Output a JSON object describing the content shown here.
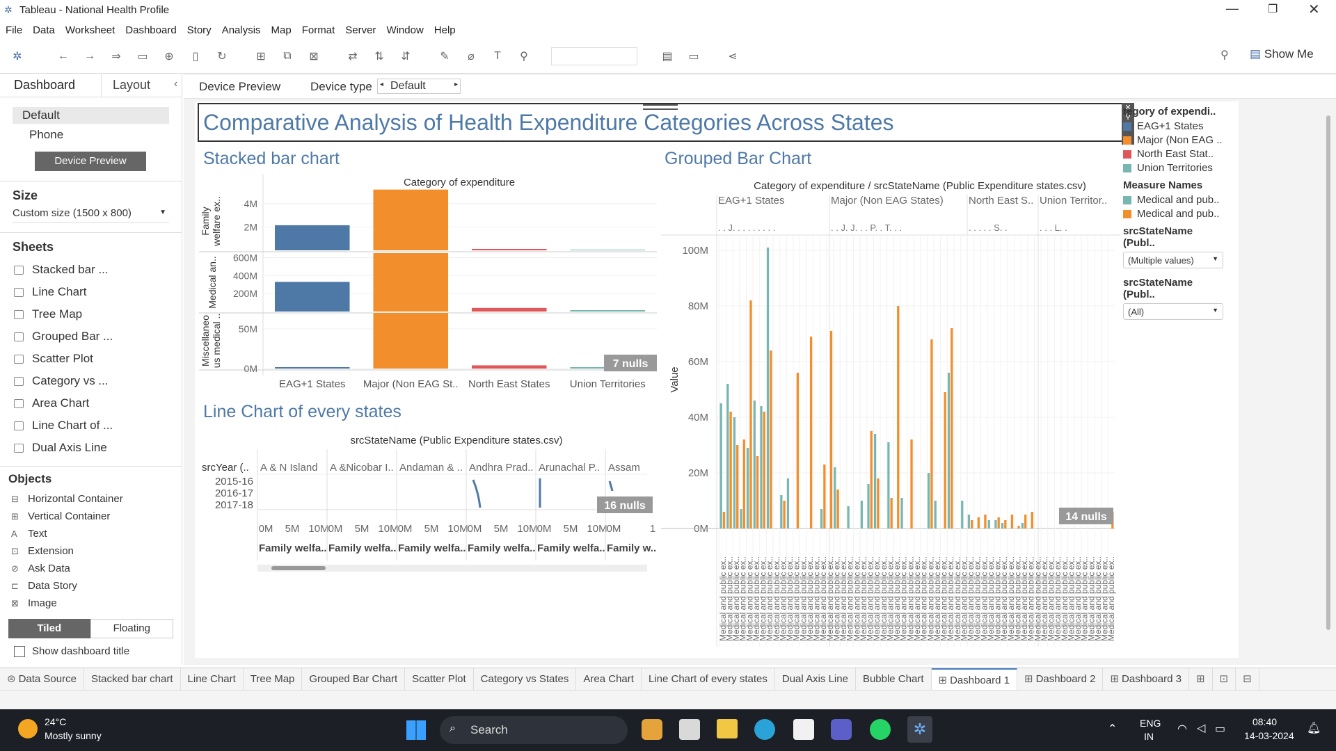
{
  "window": {
    "title": "Tableau - National Health Profile"
  },
  "menu": [
    "File",
    "Data",
    "Worksheet",
    "Dashboard",
    "Story",
    "Analysis",
    "Map",
    "Format",
    "Server",
    "Window",
    "Help"
  ],
  "toolbar": {
    "show_me": "Show Me"
  },
  "left": {
    "tab_dashboard": "Dashboard",
    "tab_layout": "Layout",
    "device_default": "Default",
    "device_phone": "Phone",
    "device_preview_btn": "Device Preview",
    "size_heading": "Size",
    "size_value": "Custom size (1500 x 800)",
    "sheets_heading": "Sheets",
    "sheets": [
      "Stacked bar ...",
      "Line Chart",
      "Tree Map",
      "Grouped Bar ...",
      "Scatter Plot",
      "Category vs ...",
      "Area Chart",
      "Line Chart of ...",
      "Dual Axis Line"
    ],
    "objects_heading": "Objects",
    "objects": [
      "Horizontal Container",
      "Vertical Container",
      "Text",
      "Extension",
      "Ask Data",
      "Data Story",
      "Image"
    ],
    "tiled": "Tiled",
    "floating": "Floating",
    "show_title": "Show dashboard title"
  },
  "devicebar": {
    "preview": "Device Preview",
    "type_label": "Device type",
    "type_value": "Default"
  },
  "dashboard": {
    "title": "Comparative Analysis of Health Expenditure Categories Across States",
    "stacked_title": "Stacked bar chart",
    "grouped_title": "Grouped Bar Chart",
    "line_title": "Line Chart of every states"
  },
  "legend": {
    "cat_title": "tegory of expendi..",
    "cat_items": [
      "EAG+1 States",
      "Major (Non EAG ..",
      "North East Stat..",
      "Union Territories"
    ],
    "measure_title": "Measure Names",
    "measure_items": [
      "Medical and pub..",
      "Medical and pub.."
    ],
    "filter1_title": "srcStateName (Publ..",
    "filter1_value": "(Multiple values)",
    "filter2_title": "srcStateName (Publ..",
    "filter2_value": "(All)"
  },
  "colors": {
    "blue": "#4e79a7",
    "orange": "#f28e2b",
    "red": "#e15759",
    "teal": "#76b7b2",
    "title": "#4e79a7"
  },
  "chart_data": [
    {
      "type": "bar",
      "header": "Category of expenditure",
      "categories": [
        "EAG+1 States",
        "Major (Non EAG St..",
        "North East States",
        "Union Territories"
      ],
      "panes": [
        {
          "label_lines": [
            "Family",
            "welfare ex.."
          ],
          "ticks": [
            "4M",
            "2M"
          ],
          "ymax": 5000000,
          "values": [
            2150000,
            5200000,
            90000,
            0
          ]
        },
        {
          "label_lines": [
            "Medical an.."
          ],
          "ticks": [
            "600M",
            "400M",
            "200M"
          ],
          "ymax": 650000000,
          "values": [
            330000000,
            650000000,
            40000000,
            8000000
          ]
        },
        {
          "label_lines": [
            "Miscellaneo",
            "us medical .."
          ],
          "ticks": [
            "50M",
            "0M"
          ],
          "ymax": 70000000,
          "values": [
            1000000,
            70000000,
            4000000,
            500000
          ]
        }
      ],
      "nulls": "7 nulls"
    },
    {
      "type": "line",
      "header": "srcStateName (Public Expenditure states.csv)",
      "row_field": "srcYear (..",
      "years": [
        "2015-16",
        "2016-17",
        "2017-18"
      ],
      "states": [
        "A & N Island",
        "A &Nicobar I..",
        "Andaman & ..",
        "Andhra Prad..",
        "Arunachal P..",
        "Assam"
      ],
      "x_ticks": [
        "0M",
        "5M",
        "10M"
      ],
      "x_label": "Family welfa..",
      "x_label_last": "Family w..",
      "x_tick_last": "1",
      "nulls": "16 nulls"
    },
    {
      "type": "bar",
      "header": "Category of expenditure / srcStateName (Public Expenditure states.csv)",
      "groups": [
        "EAG+1 States",
        "Major (Non EAG States)",
        "North East S..",
        "Union Territor.."
      ],
      "group_marks": [
        ". . J. . . . . . . . .",
        ". . J. J. . . P. . T. . .",
        ". . . . . S. .",
        ". . . L. ."
      ],
      "ylabel": "Value",
      "yticks": [
        "100M",
        "80M",
        "60M",
        "40M",
        "20M",
        "0M"
      ],
      "ylim": [
        0,
        110000000
      ],
      "series_colors": [
        "#76b7b2",
        "#f28e2b"
      ],
      "values": [
        [
          45,
          6
        ],
        [
          52,
          42
        ],
        [
          40,
          30
        ],
        [
          7,
          32
        ],
        [
          29,
          82
        ],
        [
          46,
          26
        ],
        [
          44,
          42
        ],
        [
          101,
          64
        ],
        [
          0,
          0
        ],
        [
          12,
          10
        ],
        [
          18,
          0
        ],
        [
          0,
          56
        ],
        [
          0,
          0
        ],
        [
          0,
          69
        ],
        [
          0,
          0
        ],
        [
          7,
          23
        ],
        [
          0,
          71
        ],
        [
          22,
          14
        ],
        [
          0,
          0
        ],
        [
          8,
          0
        ],
        [
          0,
          0
        ],
        [
          10,
          0
        ],
        [
          16,
          35
        ],
        [
          34,
          18
        ],
        [
          0,
          0
        ],
        [
          31,
          11
        ],
        [
          0,
          80
        ],
        [
          11,
          0
        ],
        [
          0,
          32
        ],
        [
          0,
          0
        ],
        [
          0,
          0
        ],
        [
          20,
          68
        ],
        [
          10,
          0
        ],
        [
          0,
          49
        ],
        [
          56,
          72
        ],
        [
          0,
          0
        ],
        [
          10,
          0
        ],
        [
          5,
          3
        ],
        [
          0,
          4
        ],
        [
          0,
          5
        ],
        [
          3,
          0
        ],
        [
          3,
          4
        ],
        [
          2,
          3
        ],
        [
          0,
          5
        ],
        [
          0,
          1
        ],
        [
          2,
          5
        ],
        [
          0,
          6
        ],
        [
          0,
          0
        ],
        [
          0,
          0
        ],
        [
          0,
          0
        ],
        [
          0,
          0
        ],
        [
          0,
          0
        ],
        [
          0,
          0
        ],
        [
          0,
          0
        ],
        [
          0,
          0
        ],
        [
          0,
          0
        ],
        [
          0,
          0
        ],
        [
          0,
          0
        ],
        [
          0,
          6
        ]
      ],
      "x_tick_label": "Medical and public ex..",
      "nulls": "14 nulls"
    }
  ],
  "bottom_tabs": [
    "Data Source",
    "Stacked bar chart",
    "Line Chart",
    "Tree Map",
    "Grouped Bar Chart",
    "Scatter Plot",
    "Category vs States",
    "Area Chart",
    "Line Chart of every states",
    "Dual Axis Line",
    "Bubble Chart",
    "Dashboard 1",
    "Dashboard 2",
    "Dashboard 3"
  ],
  "active_tab": "Dashboard 1",
  "taskbar": {
    "temp": "24°C",
    "weather": "Mostly sunny",
    "search": "Search",
    "lang1": "ENG",
    "lang2": "IN",
    "time": "08:40",
    "date": "14-03-2024"
  }
}
